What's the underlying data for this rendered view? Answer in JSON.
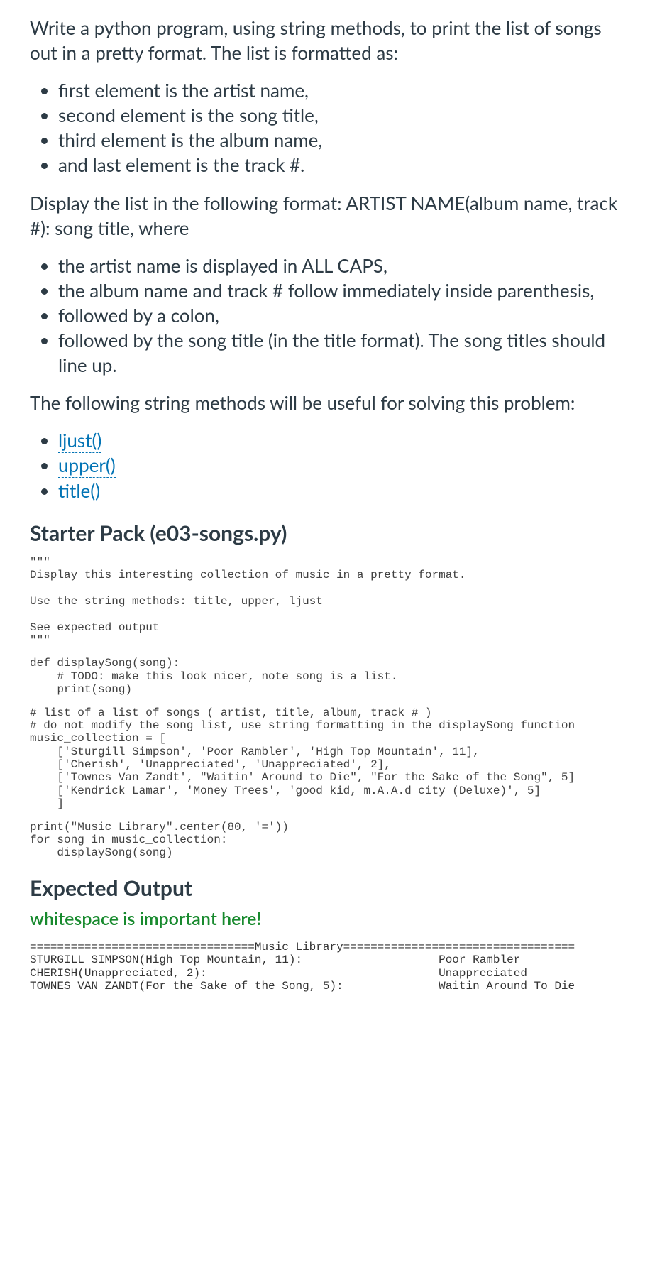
{
  "intro": "Write a python program, using string methods, to print the list of songs out in a pretty format. The list is formatted as:",
  "list1": [
    "first element is the artist name,",
    "second element is the song title,",
    "third element is the album name,",
    "and last element is the track #."
  ],
  "displayIntro": "Display the list in the following format: ARTIST NAME(album name, track #): song title, where",
  "list2": [
    "the artist name is displayed in ALL CAPS,",
    "the album name and track # follow immediately inside parenthesis,",
    "followed by a colon,",
    "followed by the song title (in the title format). The song titles should line up."
  ],
  "methodsIntro": "The following string methods will be useful for solving this problem:",
  "methodLinks": [
    "ljust()",
    "upper()",
    "title()"
  ],
  "starterHeading": "Starter Pack (e03-songs.py)",
  "code1": "\"\"\"\nDisplay this interesting collection of music in a pretty format.\n\nUse the string methods: title, upper, ljust\n\nSee expected output\n\"\"\"",
  "code2": "def displaySong(song):\n    # TODO: make this look nicer, note song is a list.\n    print(song)",
  "code3": "# list of a list of songs ( artist, title, album, track # )\n# do not modify the song list, use string formatting in the displaySong function\nmusic_collection = [\n    ['Sturgill Simpson', 'Poor Rambler', 'High Top Mountain', 11],\n    ['Cherish', 'Unappreciated', 'Unappreciated', 2],\n    ['Townes Van Zandt', \"Waitin' Around to Die\", \"For the Sake of the Song\", 5]\n    ['Kendrick Lamar', 'Money Trees', 'good kid, m.A.A.d city (Deluxe)', 5]\n    ]",
  "code4": "print(\"Music Library\".center(80, '='))\nfor song in music_collection:\n    displaySong(song)",
  "expectedHeading": "Expected Output",
  "importantNote": "whitespace is important here!",
  "output": "=================================Music Library==================================\nSTURGILL SIMPSON(High Top Mountain, 11):                    Poor Rambler\nCHERISH(Unappreciated, 2):                                  Unappreciated\nTOWNES VAN ZANDT(For the Sake of the Song, 5):              Waitin Around To Die"
}
